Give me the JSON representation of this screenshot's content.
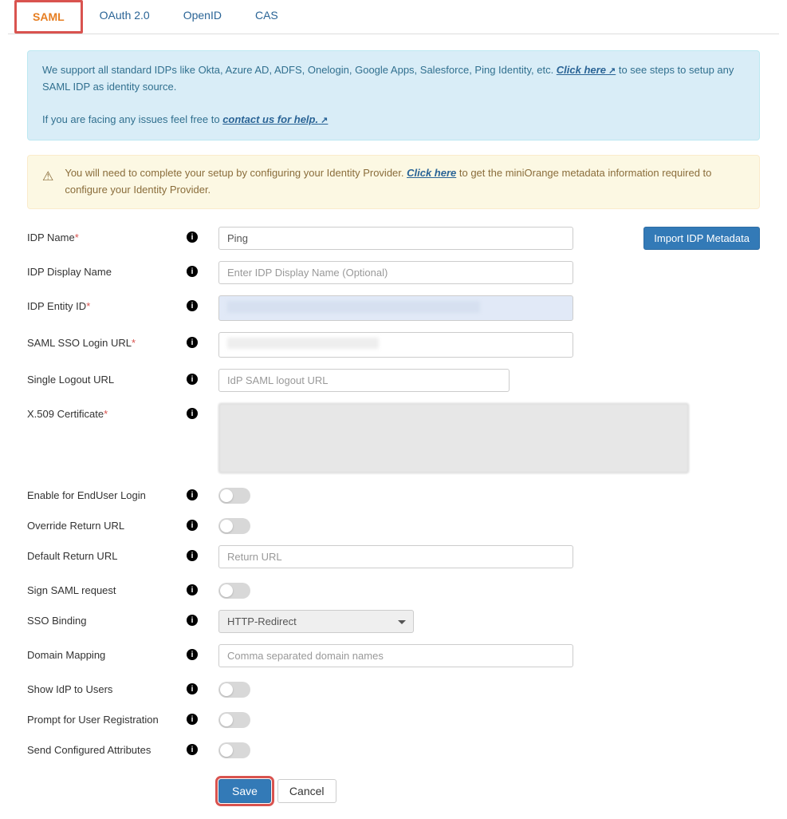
{
  "tabs": {
    "saml": "SAML",
    "oauth": "OAuth 2.0",
    "openid": "OpenID",
    "cas": "CAS"
  },
  "alerts": {
    "info_text1": "We support all standard IDPs like Okta, Azure AD, ADFS, Onelogin, Google Apps, Salesforce, Ping Identity, etc. ",
    "info_link1": "Click here",
    "info_text2": " to see steps to setup any SAML IDP as identity source.",
    "info_text3": "If you are facing any issues feel free to ",
    "info_link2": "contact us for help.",
    "warn_text1": "You will need to complete your setup by configuring your Identity Provider. ",
    "warn_link": "Click here",
    "warn_text2": " to get the miniOrange metadata information required to configure your Identity Provider."
  },
  "form": {
    "idp_name_label": "IDP Name",
    "idp_name_value": "Ping",
    "idp_display_label": "IDP Display Name",
    "idp_display_placeholder": "Enter IDP Display Name (Optional)",
    "idp_entity_label": "IDP Entity ID",
    "saml_sso_label": "SAML SSO Login URL",
    "slo_label": "Single Logout URL",
    "slo_placeholder": "IdP SAML logout URL",
    "x509_label": "X.509 Certificate",
    "enable_enduser_label": "Enable for EndUser Login",
    "override_return_label": "Override Return URL",
    "default_return_label": "Default Return URL",
    "default_return_placeholder": "Return URL",
    "sign_saml_label": "Sign SAML request",
    "sso_binding_label": "SSO Binding",
    "sso_binding_value": "HTTP-Redirect",
    "domain_mapping_label": "Domain Mapping",
    "domain_mapping_placeholder": "Comma separated domain names",
    "show_idp_label": "Show IdP to Users",
    "prompt_user_label": "Prompt for User Registration",
    "send_attrs_label": "Send Configured Attributes"
  },
  "buttons": {
    "import": "Import IDP Metadata",
    "save": "Save",
    "cancel": "Cancel"
  }
}
